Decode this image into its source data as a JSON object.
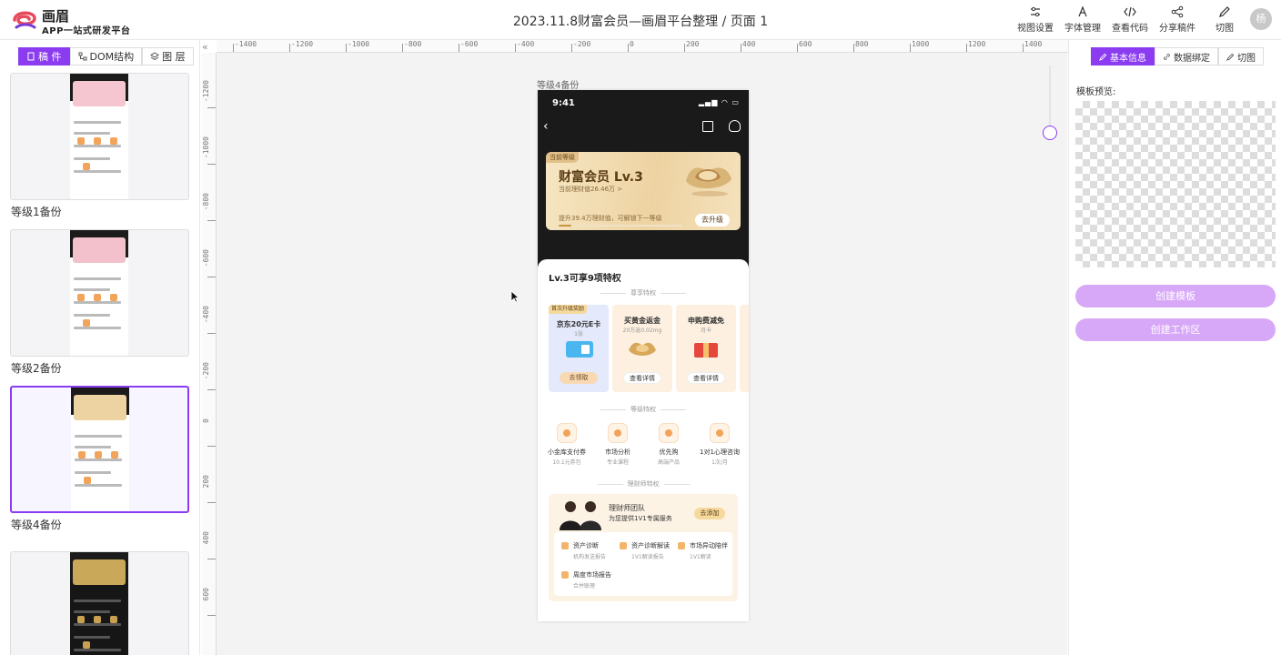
{
  "app": {
    "name": "画眉",
    "subtitle": "APP一站式研发平台",
    "doc_title": "2023.11.8财富会员—画眉平台整理 / 页面 1",
    "avatar_text": "杨"
  },
  "toolbar": [
    {
      "label": "视图设置",
      "icon": "sliders-icon"
    },
    {
      "label": "字体管理",
      "icon": "font-icon"
    },
    {
      "label": "查看代码",
      "icon": "code-icon"
    },
    {
      "label": "分享稿件",
      "icon": "share-icon"
    },
    {
      "label": "切图",
      "icon": "pen-icon"
    }
  ],
  "left_tabs": [
    {
      "label": "稿 件",
      "icon": "doc-icon",
      "active": true
    },
    {
      "label": "DOM结构",
      "icon": "tree-icon",
      "active": false
    },
    {
      "label": "图 层",
      "icon": "layers-icon",
      "active": false
    }
  ],
  "thumbnails": [
    {
      "label": "等级1备份",
      "selected": false,
      "card_color": "#f5c6cf",
      "dark": false
    },
    {
      "label": "等级2备份",
      "selected": false,
      "card_color": "#f2c1cb",
      "dark": false
    },
    {
      "label": "等级4备份",
      "selected": true,
      "card_color": "#eed3a2",
      "dark": false
    },
    {
      "label": "",
      "selected": false,
      "card_color": "#caa85a",
      "dark": true
    }
  ],
  "ruler": {
    "h": [
      "-1400",
      "-1200",
      "-1000",
      "-800",
      "-600",
      "-400",
      "-200",
      "0",
      "200",
      "400",
      "600",
      "800",
      "1000",
      "1200",
      "1400"
    ],
    "v": [
      "-1200",
      "-1000",
      "-800",
      "-600",
      "-400",
      "-200",
      "0",
      "200",
      "400",
      "600"
    ]
  },
  "frame": {
    "label": "等级4备份",
    "status_time": "9:41",
    "level_card": {
      "tag": "当前等级",
      "title": "财富会员 Lv.3",
      "sub": "当前理财值26.46万 >",
      "tip": "提升39.4万理财值，可解锁下一等级",
      "button": "去升级",
      "progress": 0.1
    },
    "privilege_title": "Lv.3可享9项特权",
    "sections": {
      "exclusive": "尊享特权",
      "grade": "等级特权",
      "advisor": "理财师特权"
    },
    "benefit_cards": [
      {
        "badge": "首次升级奖励",
        "title": "京东20元E卡",
        "sub": "1张",
        "button": "去领取"
      },
      {
        "badge": "",
        "title": "买黄金返金",
        "sub": "20万返0.02mg",
        "button": "查看详情"
      },
      {
        "badge": "",
        "title": "申购费减免",
        "sub": "月卡",
        "button": "查看详情"
      }
    ],
    "grade_items": [
      {
        "title": "小金库支付券",
        "sub": "10.1元券包"
      },
      {
        "title": "市场分析",
        "sub": "专业课程"
      },
      {
        "title": "优先购",
        "sub": "高端产品"
      },
      {
        "title": "1对1心理咨询",
        "sub": "1次/月"
      }
    ],
    "advisor": {
      "title": "理财师团队",
      "sub": "为您提供1V1专属服务",
      "button": "去添加",
      "services": [
        {
          "title": "资产诊断",
          "sub": "机构发送报告"
        },
        {
          "title": "资产诊断解读",
          "sub": "1V1解读报告"
        },
        {
          "title": "市场异动陪伴",
          "sub": "1V1解读"
        },
        {
          "title": "周度市场报告",
          "sub": "合并联理"
        }
      ]
    }
  },
  "right_tabs": [
    {
      "label": "基本信息",
      "icon": "pen-icon",
      "active": true
    },
    {
      "label": "数据绑定",
      "icon": "link-icon",
      "active": false
    },
    {
      "label": "切图",
      "icon": "pen-icon",
      "active": false
    }
  ],
  "right_panel": {
    "preview_label": "模板预览:",
    "create_template": "创建模板",
    "create_workspace": "创建工作区"
  },
  "colors": {
    "accent": "#8b3cf0",
    "accent_light": "#d7a8f7",
    "gold": "#c79441"
  }
}
